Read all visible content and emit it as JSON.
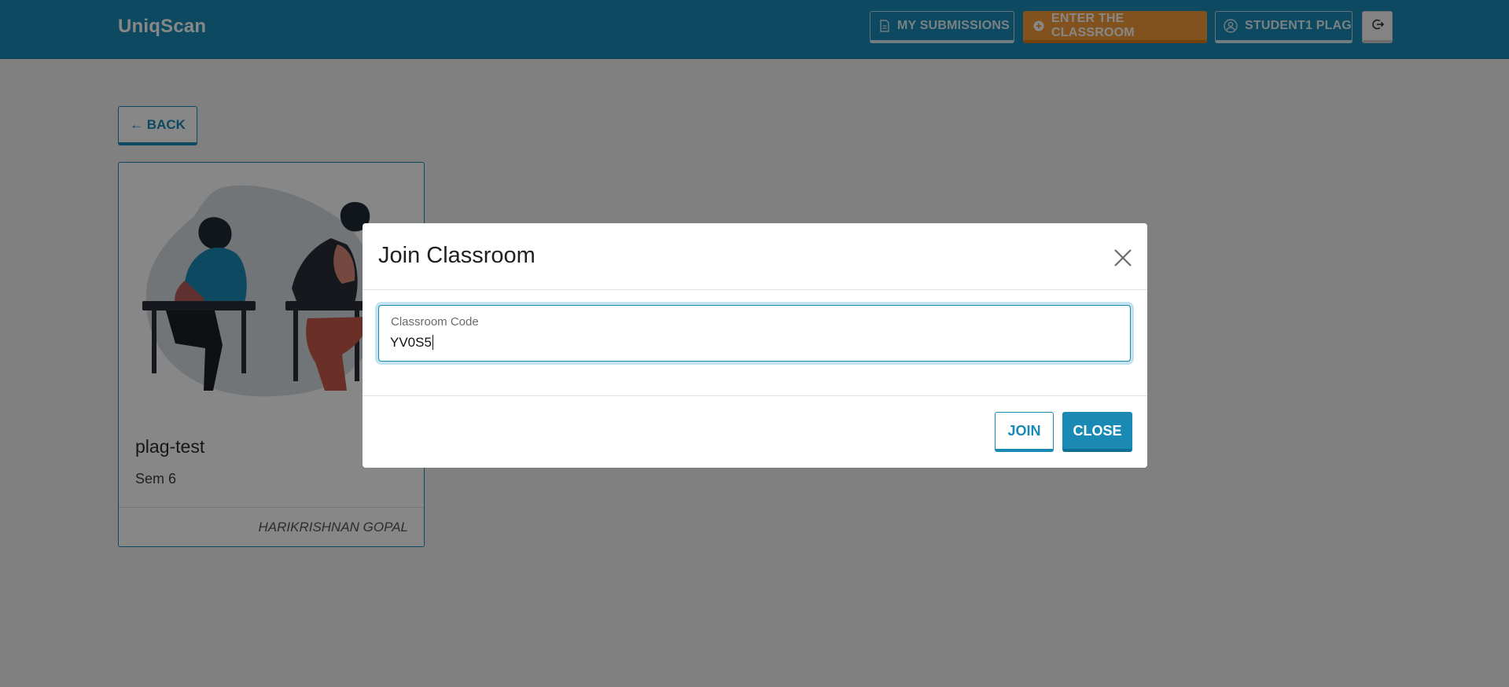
{
  "app": {
    "brand": "UniqScan"
  },
  "nav": {
    "my_submissions": "MY SUBMISSIONS",
    "enter_classroom": "ENTER THE CLASSROOM",
    "user": "STUDENT1 PLAG"
  },
  "page": {
    "back_label": "← BACK"
  },
  "card": {
    "title": "plag-test",
    "subtitle": "Sem 6",
    "owner": "HARIKRISHNAN GOPAL"
  },
  "modal": {
    "title": "Join Classroom",
    "field_label": "Classroom Code",
    "field_value": "YV0S5",
    "join_label": "JOIN",
    "close_label": "CLOSE"
  },
  "colors": {
    "primary": "#1a8ab5",
    "accent": "#f39c38"
  },
  "icons": {
    "submissions": "document-icon",
    "enter": "plus-circle-icon",
    "user": "user-circle-icon",
    "logout": "logout-icon",
    "modal_close": "close-icon"
  }
}
